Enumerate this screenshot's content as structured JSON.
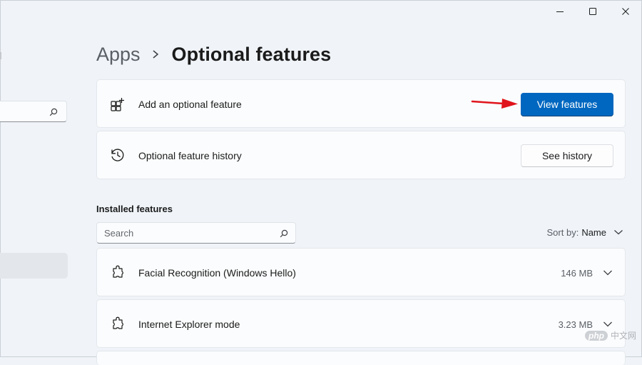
{
  "window": {
    "controls": {
      "minimize": "minimize",
      "maximize": "maximize",
      "close": "close"
    }
  },
  "breadcrumb": {
    "parent": "Apps",
    "current": "Optional features"
  },
  "add_feature": {
    "label": "Add an optional feature",
    "button": "View features",
    "icon": "add-apps-icon"
  },
  "history": {
    "label": "Optional feature history",
    "button": "See history",
    "icon": "history-icon"
  },
  "installed": {
    "title": "Installed features",
    "search_placeholder": "Search",
    "sort_label": "Sort by:",
    "sort_value": "Name",
    "items": [
      {
        "name": "Facial Recognition (Windows Hello)",
        "size": "146 MB",
        "icon": "puzzle-icon"
      },
      {
        "name": "Internet Explorer mode",
        "size": "3.23 MB",
        "icon": "puzzle-icon"
      }
    ]
  },
  "colors": {
    "accent": "#0067c0",
    "annotation_arrow": "#e0141c",
    "background": "#f0f4f9",
    "card": "#fbfcfd"
  },
  "watermark": {
    "badge": "php",
    "text": "中文网"
  }
}
